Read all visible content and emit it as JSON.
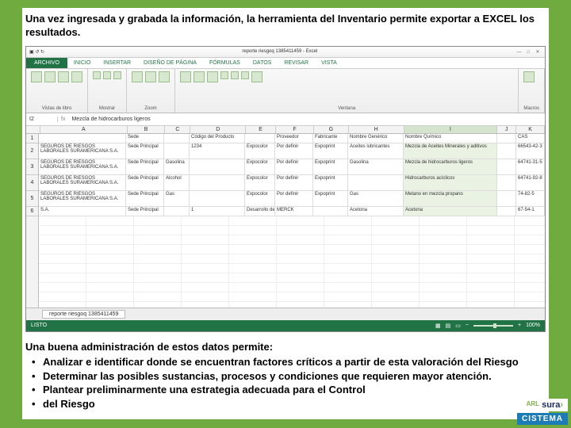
{
  "intro": "Una vez ingresada y grabada la información, la herramienta del Inventario permite exportar a EXCEL los resultados.",
  "excel": {
    "title_center": "reporte riesgoq 1385411459 - Excel",
    "win_min": "—",
    "win_max": "□",
    "win_close": "✕",
    "tabs": {
      "file": "ARCHIVO",
      "home": "INICIO",
      "insert": "INSERTAR",
      "layout": "DISEÑO DE PÁGINA",
      "formulas": "FÓRMULAS",
      "data": "DATOS",
      "review": "REVISAR",
      "view": "VISTA"
    },
    "ribbon": {
      "g1": "Vistas de libro",
      "g2": "Mostrar",
      "g3": "Zoom",
      "g4": "Ventana",
      "g5": "Macros"
    },
    "namebox": "I2",
    "fx": "fx",
    "formula": "Mezcla de hidrocarburos ligeros",
    "cols": [
      "A",
      "B",
      "C",
      "D",
      "E",
      "F",
      "G",
      "H",
      "I",
      "J",
      "K"
    ],
    "header_row": {
      "a": "",
      "b": "Sede",
      "c": "",
      "d": "Código del Producto",
      "e": "",
      "f": "Proveedor",
      "g": "Fabricante",
      "h": "Nombre Genérico",
      "i": "Nombre Químico",
      "j": "",
      "k": "CAS"
    },
    "rows": [
      {
        "a": "SEGUROS DE RIESGOS LABORALES SURAMERICANA S.A.",
        "b": "Sede Principal",
        "c": "",
        "d": "1234",
        "e": "Expocolor",
        "f": "Por definir",
        "g": "Expoprint",
        "h": "Aceites lubricantes",
        "i": "Mezcla de Aceites Minerales y aditivos",
        "j": "",
        "k": "66543-42-3"
      },
      {
        "a": "SEGUROS DE RIESGOS LABORALES SURAMERICANA S.A.",
        "b": "Sede Principal",
        "c": "Gasolina",
        "d": "",
        "e": "Expocolor",
        "f": "Por definir",
        "g": "Expoprint",
        "h": "Gasolina",
        "i": "Mezcla de hidrocarburos ligeros",
        "j": "",
        "k": "64741-31-5"
      },
      {
        "a": "SEGUROS DE RIESGOS LABORALES SURAMERICANA S.A.",
        "b": "Sede Principal",
        "c": "Alcohol",
        "d": "",
        "e": "Expocolor",
        "f": "Por definir",
        "g": "Expoprint",
        "h": "",
        "i": "Hidrocarburos acíclicos",
        "j": "",
        "k": "64741-92-8"
      },
      {
        "a": "SEGUROS DE RIESGOS LABORALES SURAMERICANA S.A.",
        "b": "Sede Principal",
        "c": "Gas",
        "d": "",
        "e": "Expocolor",
        "f": "Por definir",
        "g": "Expoprint",
        "h": "Gas",
        "i": "Metano en mezcla propano",
        "j": "",
        "k": "74-82-5"
      },
      {
        "a": "S.A.",
        "b": "Sede Principal",
        "c": "",
        "d": "1",
        "e": "Desarrollo de Productos Químicos, S.A.",
        "f": "MERCK",
        "g": "",
        "h": "Acetona",
        "i": "Acetona",
        "j": "",
        "k": "67-54-1"
      }
    ],
    "sheet_tab": "reporte riesgoq 1385411459",
    "status_left": "LISTO",
    "zoom_pct": "100%"
  },
  "outro_heading": "Una buena administración de estos datos permite:",
  "bullets": [
    "Analizar e identificar donde se encuentran factores críticos a partir de  esta valoración del Riesgo",
    "Determinar las posibles sustancias, procesos y condiciones que requieren mayor atención.",
    "Plantear preliminarmente una estrategia adecuada para el Control",
    "del Riesgo"
  ],
  "logos": {
    "arl": "ARL",
    "sura": "sura",
    "arrow": "›",
    "cistema": "CISTEMA"
  }
}
